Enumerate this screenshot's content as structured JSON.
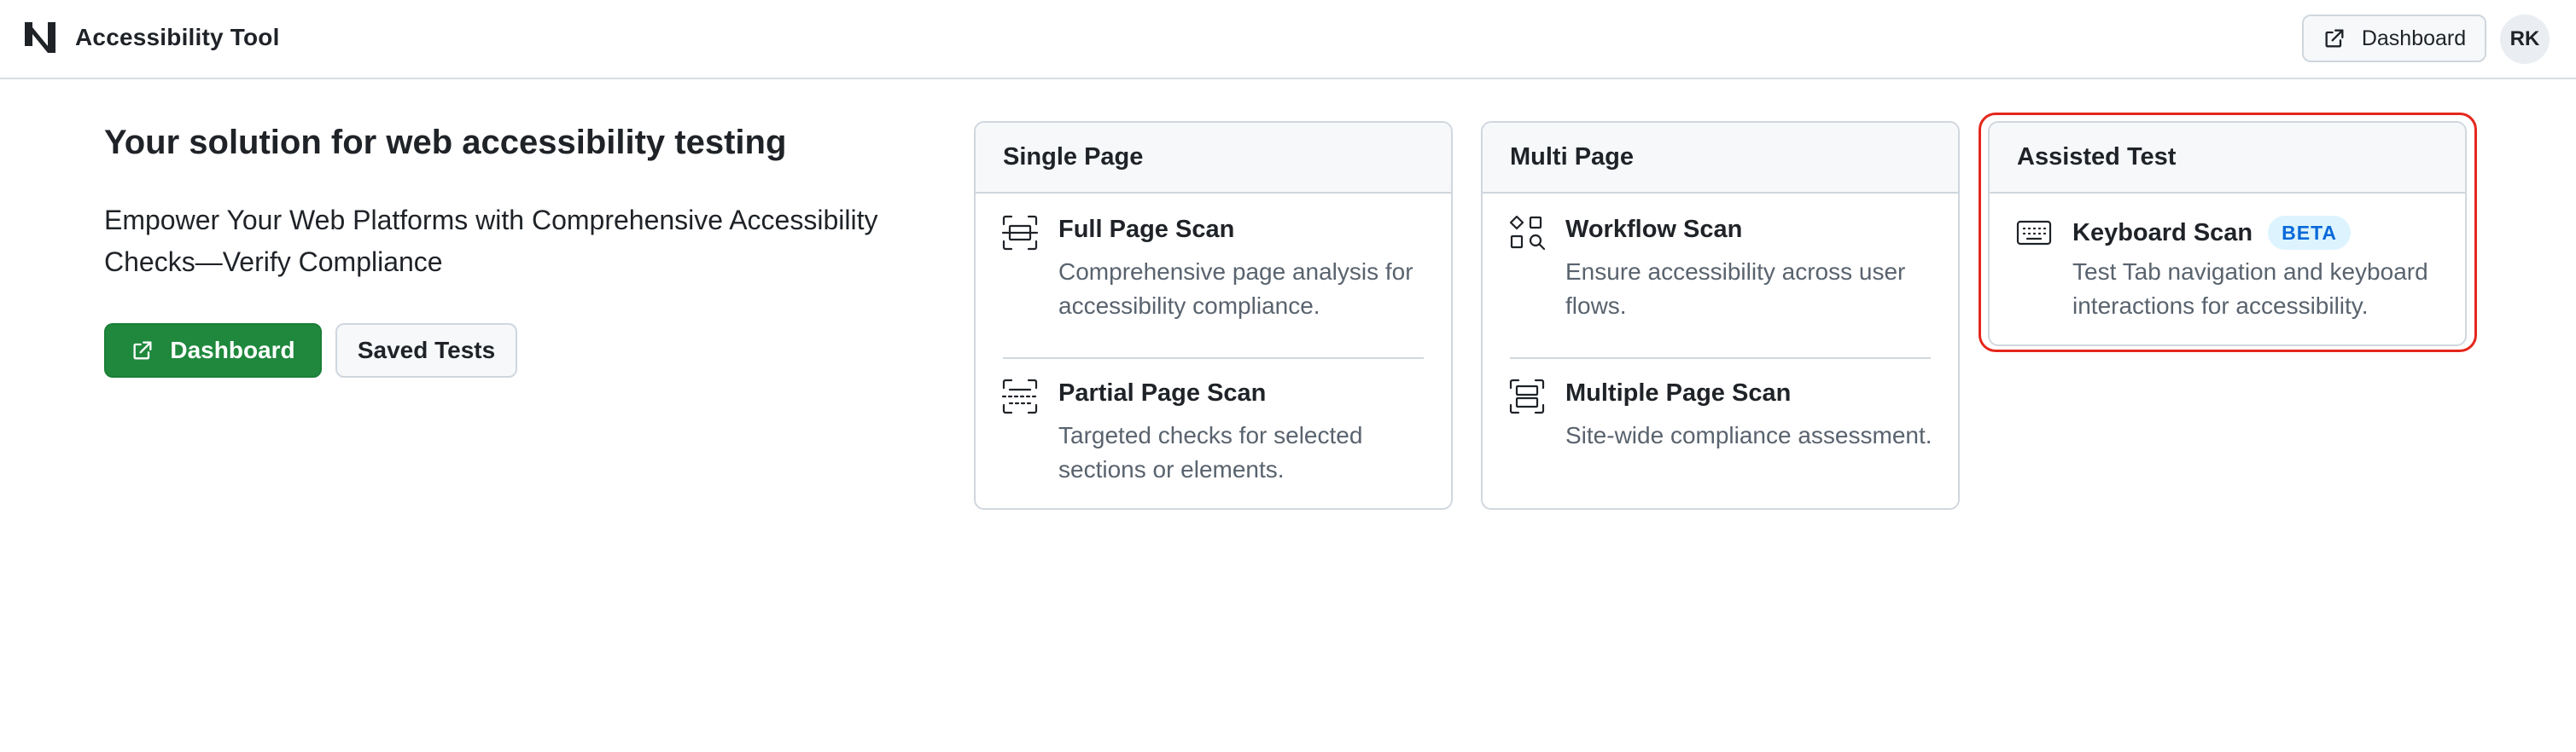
{
  "header": {
    "app_name": "Accessibility Tool",
    "logo_icon": "brand-logo-icon",
    "dashboard_button": {
      "label": "Dashboard",
      "icon": "external-link-icon"
    },
    "avatar_initials": "RK"
  },
  "hero": {
    "title": "Your solution for web accessibility testing",
    "subtitle": "Empower Your Web Platforms with Comprehensive Accessibility Checks—Verify Compliance",
    "primary_button": {
      "label": "Dashboard",
      "icon": "external-link-icon"
    },
    "secondary_button": {
      "label": "Saved Tests"
    }
  },
  "cards": [
    {
      "title": "Single Page",
      "items": [
        {
          "title": "Full Page Scan",
          "description": "Comprehensive page analysis for accessibility compliance.",
          "icon": "full-page-scan-icon"
        },
        {
          "title": "Partial Page Scan",
          "description": "Targeted checks for selected sections or elements.",
          "icon": "partial-page-scan-icon"
        }
      ]
    },
    {
      "title": "Multi Page",
      "items": [
        {
          "title": "Workflow Scan",
          "description": "Ensure accessibility across user flows.",
          "icon": "workflow-scan-icon"
        },
        {
          "title": "Multiple Page Scan",
          "description": "Site-wide compliance assessment.",
          "icon": "multiple-page-scan-icon"
        }
      ]
    },
    {
      "title": "Assisted Test",
      "items": [
        {
          "title": "Keyboard Scan",
          "badge": "BETA",
          "description": "Test Tab navigation and keyboard interactions for accessibility.",
          "icon": "keyboard-icon"
        }
      ]
    }
  ],
  "colors": {
    "primary_green": "#1f883d",
    "badge_blue": "#0969da",
    "badge_bg": "#ddf4ff",
    "highlight_red": "#e5261c",
    "border": "#d0d7de",
    "muted_text": "#59636e"
  }
}
